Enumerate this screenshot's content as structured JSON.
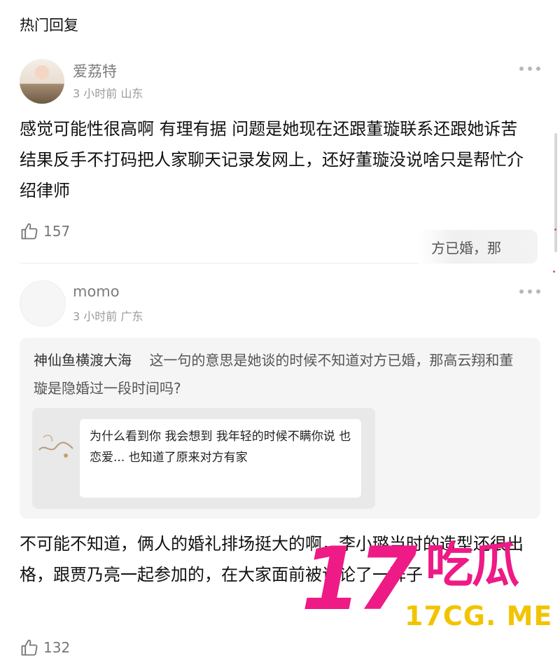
{
  "section": {
    "title": "热门回复"
  },
  "comments": [
    {
      "username": "爱荔特",
      "time": "3 小时前",
      "location": "山东",
      "body": "感觉可能性很高啊 有理有据 问题是她现在还跟董璇联系还跟她诉苦 结果反手不打码把人家聊天记录发网上，还好董璇没说啥只是帮忙介绍律师",
      "likes": "157"
    },
    {
      "username": "momo",
      "time": "3 小时前",
      "location": "广东",
      "quote": {
        "user": "神仙鱼横渡大海",
        "text": "这一句的意思是她谈的时候不知道对方已婚，那高云翔和董璇是隐婚过一段时间吗?",
        "image_text": "为什么看到你 我会想到 我年轻的时候不瞒你说 也恋爱... 也知道了原来对方有家"
      },
      "body": "不可能不知道，俩人的婚礼排场挺大的啊，李小璐当时的造型还很出格，跟贾乃亮一起参加的，在大家面前被议论了一阵子",
      "likes": "132"
    }
  ],
  "overlay_snippet": "方已婚，那",
  "watermark": {
    "number": "17",
    "chars": "吃瓜",
    "url": "17CG. ME"
  },
  "colors": {
    "watermark_pink": "#ee1a86",
    "watermark_yellow": "#f2c400"
  },
  "icons": {
    "like": "thumbs-up-icon",
    "more": "more-dots-icon"
  }
}
